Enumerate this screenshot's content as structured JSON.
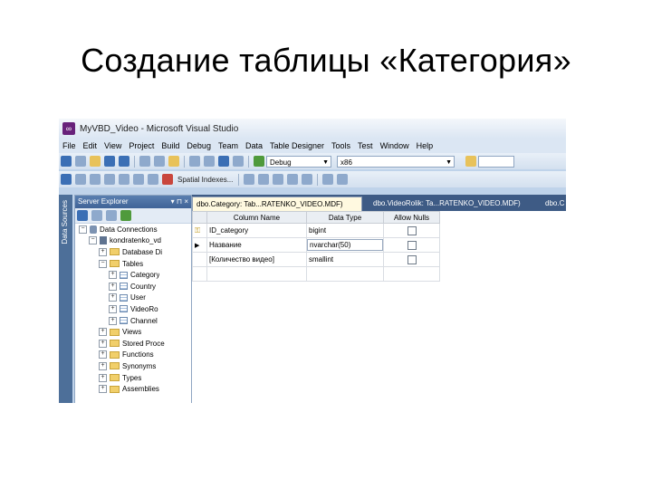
{
  "slide": {
    "title": "Создание таблицы «Категория»"
  },
  "window": {
    "title": "MyVBD_Video - Microsoft Visual Studio",
    "logo": "visual-studio-logo"
  },
  "menu": [
    "File",
    "Edit",
    "View",
    "Project",
    "Build",
    "Debug",
    "Team",
    "Data",
    "Table Designer",
    "Tools",
    "Test",
    "Window",
    "Help"
  ],
  "toolbar": {
    "config_value": "Debug",
    "platform_value": "x86",
    "spatial_indexes_label": "Spatial Indexes..."
  },
  "side_tab": {
    "label": "Data Sources"
  },
  "server_explorer": {
    "title": "Server Explorer",
    "controls": "▾ ⊓ ×",
    "tree": [
      {
        "label": "Data Connections",
        "level": 0,
        "expander": "−",
        "icon": "database-icon"
      },
      {
        "label": "kondratenko_vd",
        "level": 1,
        "expander": "−",
        "icon": "server-icon"
      },
      {
        "label": "Database Di",
        "level": 2,
        "expander": "+",
        "icon": "folder-icon"
      },
      {
        "label": "Tables",
        "level": 2,
        "expander": "−",
        "icon": "folder-icon"
      },
      {
        "label": "Category",
        "level": 3,
        "expander": "+",
        "icon": "table-icon"
      },
      {
        "label": "Country",
        "level": 3,
        "expander": "+",
        "icon": "table-icon"
      },
      {
        "label": "User",
        "level": 3,
        "expander": "+",
        "icon": "table-icon"
      },
      {
        "label": "VideoRo",
        "level": 3,
        "expander": "+",
        "icon": "table-icon"
      },
      {
        "label": "Channel",
        "level": 3,
        "expander": "+",
        "icon": "table-icon"
      },
      {
        "label": "Views",
        "level": 2,
        "expander": "+",
        "icon": "folder-icon"
      },
      {
        "label": "Stored Proce",
        "level": 2,
        "expander": "+",
        "icon": "folder-icon"
      },
      {
        "label": "Functions",
        "level": 2,
        "expander": "+",
        "icon": "folder-icon"
      },
      {
        "label": "Synonyms",
        "level": 2,
        "expander": "+",
        "icon": "folder-icon"
      },
      {
        "label": "Types",
        "level": 2,
        "expander": "+",
        "icon": "folder-icon"
      },
      {
        "label": "Assemblies",
        "level": 2,
        "expander": "+",
        "icon": "folder-icon"
      }
    ]
  },
  "document_tabs": [
    {
      "label": "dbo.Category: Tab...RATENKO_VIDEO.MDF)",
      "active": true
    },
    {
      "label": "dbo.VideoRolik: Ta...RATENKO_VIDEO.MDF)",
      "active": false
    },
    {
      "label": "dbo.C",
      "active": false
    }
  ],
  "designer": {
    "columns": [
      "Column Name",
      "Data Type",
      "Allow Nulls"
    ],
    "rows": [
      {
        "indicator": "key",
        "name": "ID_category",
        "type": "bigint",
        "allow_nulls": false
      },
      {
        "indicator": "arrow",
        "name": "Название",
        "type": "nvarchar(50)",
        "allow_nulls": false
      },
      {
        "indicator": "",
        "name": "[Количество видео]",
        "type": "smallint",
        "allow_nulls": false
      },
      {
        "indicator": "",
        "name": "",
        "type": "",
        "allow_nulls": null
      }
    ]
  },
  "colors": {
    "window_chrome": "#bfd3ea",
    "tab_strip": "#3e5b85",
    "panel_header": "#4a6fa3",
    "active_tab": "#fff9e0"
  }
}
